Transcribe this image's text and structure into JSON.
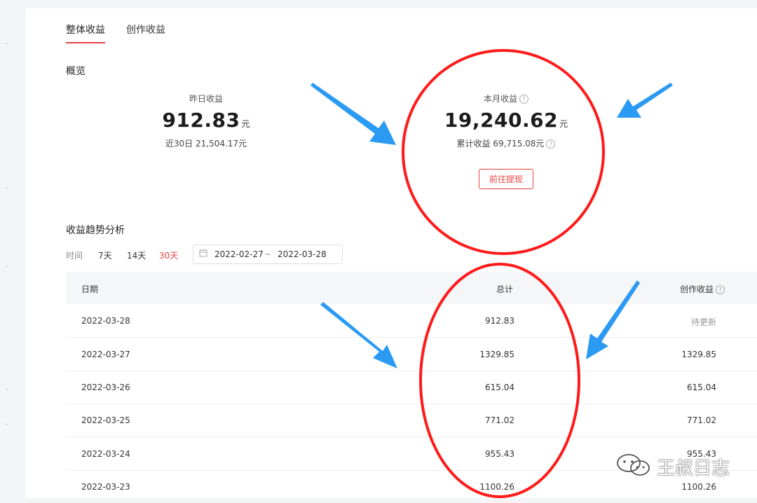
{
  "tabs": [
    {
      "label": "整体收益",
      "active": true
    },
    {
      "label": "创作收益",
      "active": false
    }
  ],
  "overview": {
    "title": "概览",
    "yesterday": {
      "label": "昨日收益",
      "value": "912.83",
      "unit": "元",
      "sub": "近30日 21,504.17元"
    },
    "month": {
      "label": "本月收益",
      "value": "19,240.62",
      "unit": "元",
      "sub": "累计收益 69,715.08元",
      "button": "前往提现"
    }
  },
  "trend": {
    "title": "收益趋势分析",
    "time_label": "时间",
    "options": [
      "7天",
      "14天",
      "30天"
    ],
    "active_option": "30天",
    "date_start": "2022-02-27",
    "date_sep": "~",
    "date_end": "2022-03-28"
  },
  "table": {
    "headers": {
      "date": "日期",
      "total": "总计",
      "creation": "创作收益"
    },
    "rows": [
      {
        "date": "2022-03-28",
        "total": "912.83",
        "creation": "待更新"
      },
      {
        "date": "2022-03-27",
        "total": "1329.85",
        "creation": "1329.85"
      },
      {
        "date": "2022-03-26",
        "total": "615.04",
        "creation": "615.04"
      },
      {
        "date": "2022-03-25",
        "total": "771.02",
        "creation": "771.02"
      },
      {
        "date": "2022-03-24",
        "total": "955.43",
        "creation": "955.43"
      },
      {
        "date": "2022-03-23",
        "total": "1100.26",
        "creation": "1100.26"
      }
    ]
  },
  "watermark": {
    "text": "王叔日志"
  },
  "colors": {
    "accent": "#e94242",
    "annotation_circle": "#ff1a1a",
    "annotation_arrow": "#2b9af3"
  }
}
